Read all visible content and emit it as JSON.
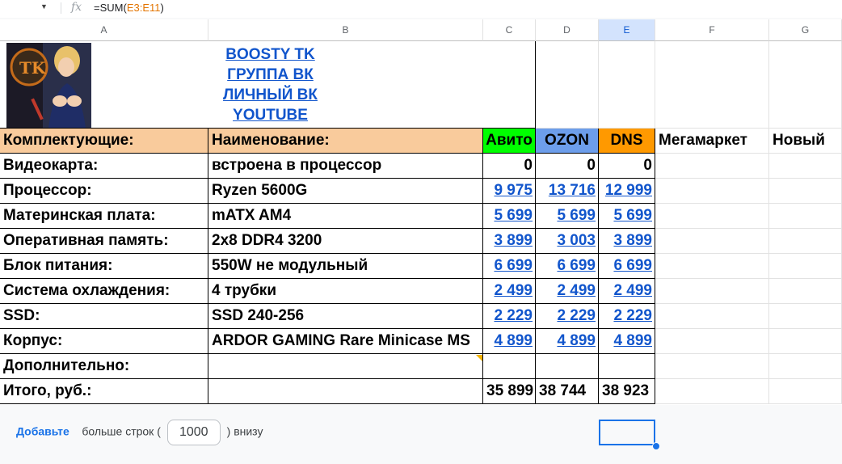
{
  "formula_bar": {
    "dropdown_icon": "triangle-down",
    "fx": "fx",
    "formula_prefix": "=SUM(",
    "formula_ref": "E3:E11",
    "formula_suffix": ")"
  },
  "columns": [
    "A",
    "B",
    "C",
    "D",
    "E",
    "F",
    "G"
  ],
  "selected_column": "E",
  "links": [
    "BOOSTY TK",
    "ГРУППА ВК",
    "ЛИЧНЫЙ ВК",
    "YOUTUBE"
  ],
  "header": {
    "components": "Комплектующие:",
    "name": "Наименование:",
    "avito": "Авито",
    "ozon": "OZON",
    "dns": "DNS",
    "megamarket": "Мегамаркет",
    "new": "Новый"
  },
  "colors": {
    "header_bg": "#f9cb9c",
    "avito": "#00ff00",
    "ozon": "#6d9eeb",
    "dns": "#ff9900",
    "link": "#1155cc",
    "selection": "#1a73e8"
  },
  "rows": [
    {
      "component": "Видеокарта:",
      "name": "встроена в процессор",
      "avito": "0",
      "ozon": "0",
      "dns": "0",
      "link": false
    },
    {
      "component": "Процессор:",
      "name": "Ryzen 5600G",
      "avito": "9 975",
      "ozon": "13 716",
      "dns": "12 999",
      "link": true
    },
    {
      "component": "Материнская плата:",
      "name": "mATX AM4",
      "avito": "5 699",
      "ozon": "5 699",
      "dns": "5 699",
      "link": true
    },
    {
      "component": "Оперативная память:",
      "name": "2x8 DDR4 3200",
      "avito": "3 899",
      "ozon": "3 003",
      "dns": "3 899",
      "link": true
    },
    {
      "component": "Блок питания:",
      "name": "550W не модульный",
      "avito": "6 699",
      "ozon": "6 699",
      "dns": "6 699",
      "link": true
    },
    {
      "component": "Система охлаждения:",
      "name": "4 трубки",
      "avito": "2 499",
      "ozon": "2 499",
      "dns": "2 499",
      "link": true
    },
    {
      "component": "SSD:",
      "name": "SSD 240-256",
      "avito": "2 229",
      "ozon": "2 229",
      "dns": "2 229",
      "link": true
    },
    {
      "component": "Корпус:",
      "name": "ARDOR GAMING Rare Minicase MS",
      "avito": "4 899",
      "ozon": "4 899",
      "dns": "4 899",
      "link": true
    },
    {
      "component": "Дополнительно:",
      "name": "",
      "avito": "",
      "ozon": "",
      "dns": "",
      "link": false
    }
  ],
  "total": {
    "label": "Итого, руб.:",
    "avito": "35 899",
    "ozon": "38 744",
    "dns": "38 923"
  },
  "footer": {
    "add_label": "Добавьте",
    "more_rows": "больше строк (",
    "rows_value": "1000",
    "suffix": ") внизу"
  }
}
